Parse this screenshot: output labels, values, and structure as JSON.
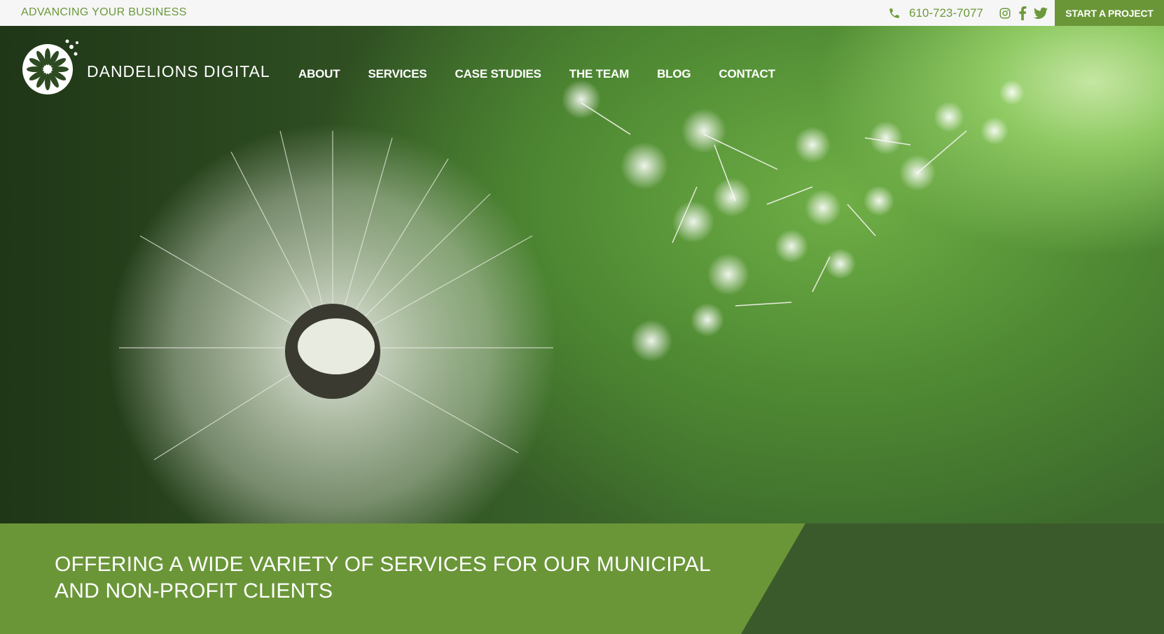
{
  "topbar": {
    "tagline": "ADVANCING YOUR BUSINESS",
    "phone": "610-723-7077",
    "cta_label": "START A PROJECT",
    "social_icons": [
      "instagram-icon",
      "facebook-icon",
      "twitter-icon"
    ]
  },
  "header": {
    "brand": "DANDELIONS DIGITAL",
    "nav": [
      "ABOUT",
      "SERVICES",
      "CASE STUDIES",
      "THE TEAM",
      "BLOG",
      "CONTACT"
    ]
  },
  "banner": {
    "headline": "OFFERING A WIDE VARIETY OF SERVICES FOR OUR MUNICIPAL AND NON-PROFIT CLIENTS"
  },
  "colors": {
    "brand_green": "#6a9638",
    "dark_green": "#3b5a2b",
    "text_green": "#6b9a3a"
  }
}
